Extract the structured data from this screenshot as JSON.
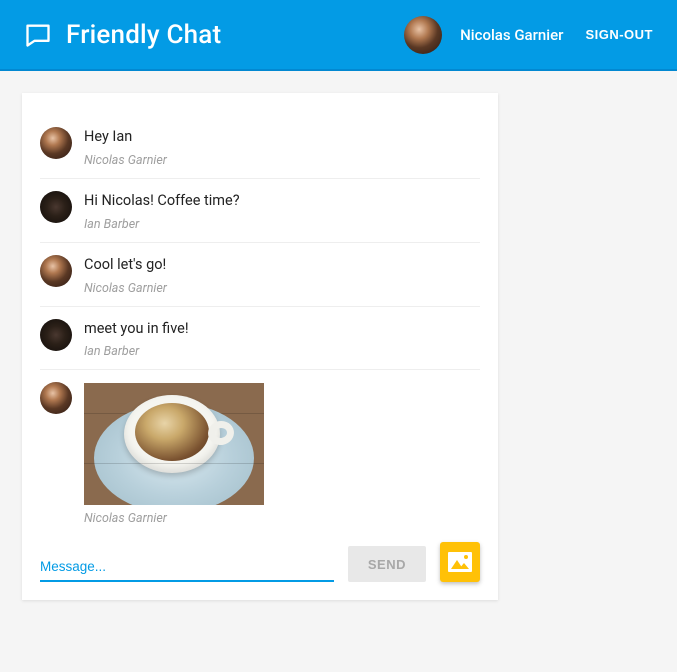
{
  "header": {
    "title": "Friendly Chat",
    "user_name": "Nicolas Garnier",
    "signout_label": "SIGN-OUT"
  },
  "messages": [
    {
      "text": "Hey Ian",
      "sender": "Nicolas Garnier",
      "avatar": "nicolas",
      "type": "text"
    },
    {
      "text": "Hi Nicolas! Coffee time?",
      "sender": "Ian Barber",
      "avatar": "ian",
      "type": "text"
    },
    {
      "text": "Cool let's go!",
      "sender": "Nicolas Garnier",
      "avatar": "nicolas",
      "type": "text"
    },
    {
      "text": "meet you in five!",
      "sender": "Ian Barber",
      "avatar": "ian",
      "type": "text"
    },
    {
      "sender": "Nicolas Garnier",
      "avatar": "nicolas",
      "type": "image"
    }
  ],
  "composer": {
    "placeholder": "Message...",
    "send_label": "SEND"
  }
}
